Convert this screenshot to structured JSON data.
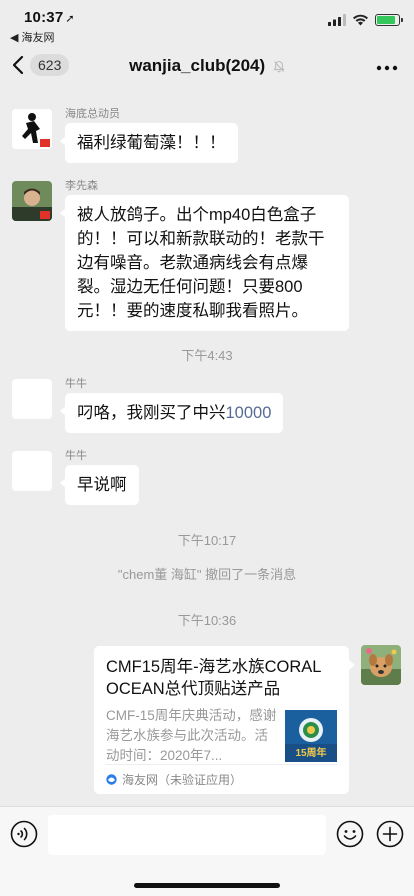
{
  "status_bar": {
    "time": "10:37",
    "back_app": "◀ 海友网",
    "battery_level": 0.85
  },
  "nav": {
    "unread_count": "623",
    "title": "wanjia_club(204)"
  },
  "messages": [
    {
      "sender": "海底总动员",
      "text": "福利绿葡萄藻！！！"
    },
    {
      "sender": "李先森",
      "text": "被人放鸽子。出个mp40白色盒子的！！可以和新款联动的！老款干边有噪音。老款通病线会有点爆裂。湿边无任何问题！只要800元！！要的速度私聊我看照片。"
    },
    {
      "sender": "牛牛",
      "text_prefix": "叼咯，我刚买了中兴",
      "text_link": "10000"
    },
    {
      "sender": "牛牛",
      "text": "早说啊"
    }
  ],
  "timestamps": [
    "下午4:43",
    "下午10:17",
    "下午10:36"
  ],
  "system_message": "\"chem董 海缸\" 撤回了一条消息",
  "link_card": {
    "title": "CMF15周年-海艺水族CORAL OCEAN总代顶贴送产品",
    "description": "CMF-15周年庆典活动，感谢海艺水族参与此次活动。活动时间：2020年7...",
    "source": "海友网（未验证应用）",
    "thumb_caption": "15周年"
  },
  "colors": {
    "background": "#ededed",
    "bubble": "#ffffff",
    "link": "#576b95",
    "battery": "#34c759"
  },
  "icons": [
    "signal-icon",
    "wifi-icon",
    "battery-icon",
    "back-chevron-icon",
    "mute-bell-icon",
    "more-icon",
    "voice-icon",
    "emoji-icon",
    "plus-icon"
  ]
}
